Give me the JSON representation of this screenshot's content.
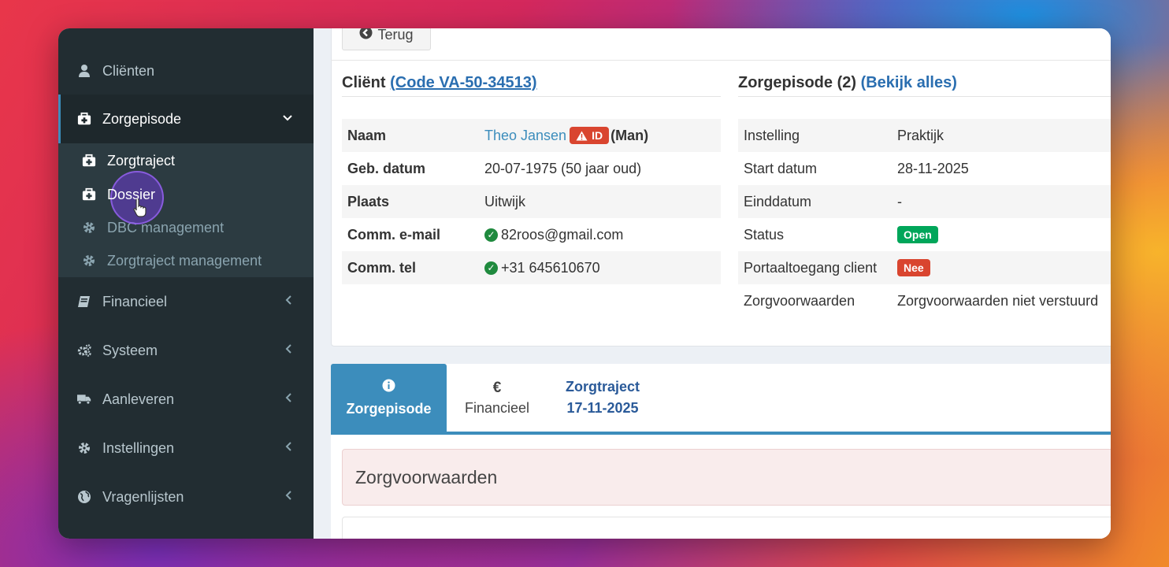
{
  "sidebar": {
    "items": [
      {
        "label": "Cliënten",
        "icon": "user-icon"
      },
      {
        "label": "Zorgepisode",
        "icon": "medkit-icon",
        "caret": "⌄"
      },
      {
        "label": "Financieel",
        "icon": "book-icon",
        "caret": "‹"
      },
      {
        "label": "Systeem",
        "icon": "gears-icon",
        "caret": "‹"
      },
      {
        "label": "Aanleveren",
        "icon": "truck-icon",
        "caret": "‹"
      },
      {
        "label": "Instellingen",
        "icon": "gear-icon",
        "caret": "‹"
      },
      {
        "label": "Vragenlijsten",
        "icon": "globe-icon",
        "caret": "‹"
      }
    ],
    "submenu": [
      {
        "label": "Zorgtraject",
        "icon": "medkit-icon"
      },
      {
        "label": "Dossier",
        "icon": "medkit-icon"
      },
      {
        "label": "DBC management",
        "icon": "gear-icon"
      },
      {
        "label": "Zorgtraject management",
        "icon": "gear-icon"
      }
    ]
  },
  "back_button": {
    "label": "Terug",
    "icon": "arrow-left-circle-icon"
  },
  "client": {
    "title": "Cliënt",
    "code_link": "(Code VA-50-34513)",
    "rows": [
      {
        "key": "Naam",
        "name": "Theo Jansen",
        "badge": "ID",
        "gender": "(Man)"
      },
      {
        "key": "Geb. datum",
        "value": "20-07-1975 (50 jaar oud)"
      },
      {
        "key": "Plaats",
        "value": "Uitwijk"
      },
      {
        "key": "Comm. e-mail",
        "value": "82roos@gmail.com"
      },
      {
        "key": "Comm. tel",
        "value": "+31 645610670"
      }
    ]
  },
  "episode": {
    "title": "Zorgepisode (2)",
    "link": "(Bekijk alles)",
    "rows": [
      {
        "key": "Instelling",
        "value": "Praktijk"
      },
      {
        "key": "Start datum",
        "value": "28-11-2025"
      },
      {
        "key": "Einddatum",
        "value": "-"
      },
      {
        "key": "Status",
        "value": "Open"
      },
      {
        "key": "Portaaltoegang client",
        "value": "Nee"
      },
      {
        "key": "Zorgvoorwaarden",
        "value": "Zorgvoorwaarden niet verstuurd"
      }
    ]
  },
  "tabs": [
    {
      "icon": "info-icon",
      "glyph": "i",
      "label": "Zorgepisode"
    },
    {
      "icon": "euro-icon",
      "glyph": "€",
      "label": "Financieel"
    },
    {
      "line1": "Zorgtraject",
      "line2": "17-11-2025"
    }
  ],
  "panel": {
    "title": "Zorgvoorwaarden"
  },
  "colors": {
    "sidebar_bg": "#222d32",
    "accent": "#3c8dbc",
    "badge_red": "#d9452f",
    "badge_green": "#00a65a"
  }
}
